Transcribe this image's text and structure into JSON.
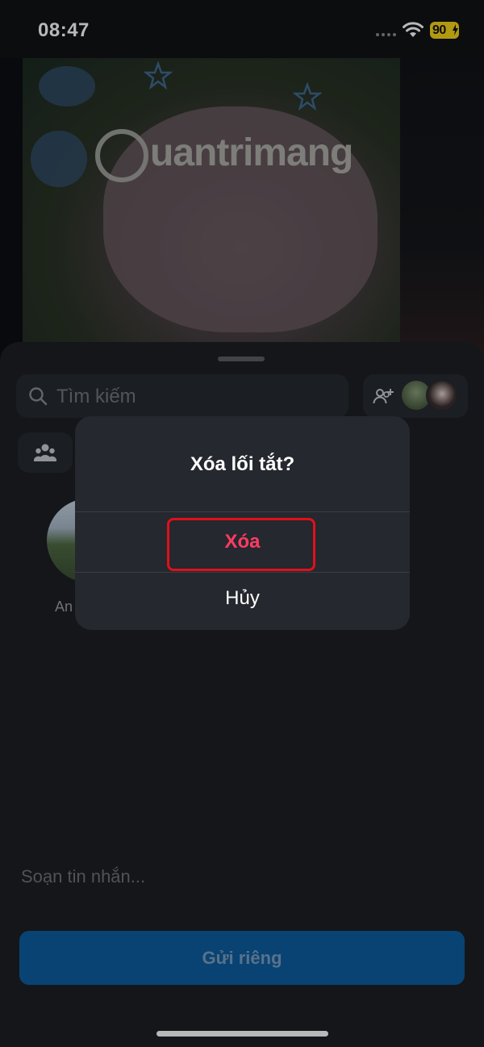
{
  "status_bar": {
    "time": "08:47",
    "battery": "90",
    "wifi_icon": "wifi-icon",
    "battery_color": "#f5d51a"
  },
  "watermark": {
    "text": "uantrimang",
    "icon": "lightbulb-icon"
  },
  "share_sheet": {
    "search_placeholder": "Tìm kiếm",
    "search_icon": "search-icon",
    "add_people_icon": "add-people-icon",
    "group_icon": "group-icon",
    "contact_name": "An",
    "message_placeholder": "Soạn tin nhắn...",
    "send_button_label": "Gửi riêng",
    "send_button_color": "#0d5ea0"
  },
  "alert": {
    "title": "Xóa lối tắt?",
    "delete_label": "Xóa",
    "cancel_label": "Hủy",
    "delete_color": "#ff3b63",
    "highlight_color": "#e0101a"
  }
}
